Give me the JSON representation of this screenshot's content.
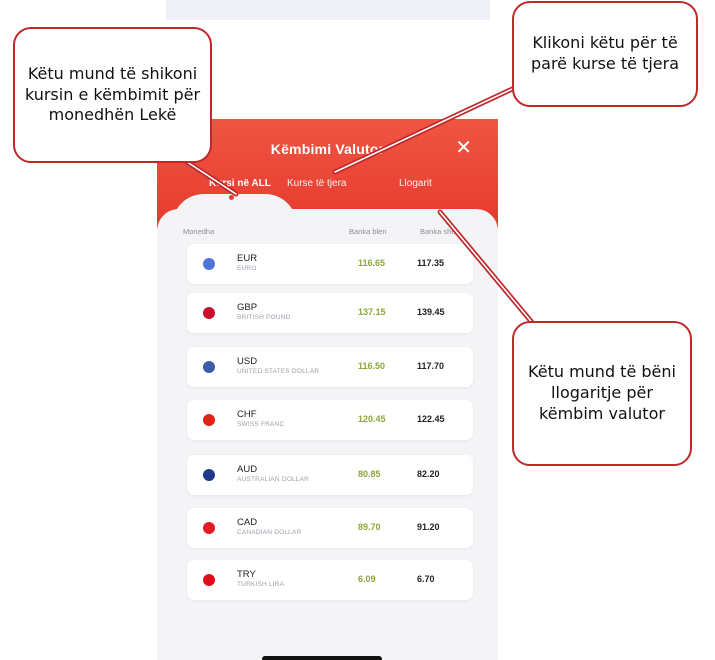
{
  "header": {
    "title": "Këmbimi Valutor",
    "close": "✕"
  },
  "tabs": [
    {
      "label": "Kursi në ALL"
    },
    {
      "label": "Kurse të tjera"
    },
    {
      "label": "Llogarit"
    }
  ],
  "columns": {
    "currency": "Monedha",
    "buy": "Banka blen",
    "sell": "Banka shet"
  },
  "rows": [
    {
      "code": "EUR",
      "name": "EURO",
      "buy": "116.65",
      "sell": "117.35",
      "flag": "#4f74d6"
    },
    {
      "code": "GBP",
      "name": "BRITISH POUND",
      "buy": "137.15",
      "sell": "139.45",
      "flag": "#c8102e"
    },
    {
      "code": "USD",
      "name": "UNITED STATES DOLLAR",
      "buy": "116.50",
      "sell": "117.70",
      "flag": "#3c5ba8"
    },
    {
      "code": "CHF",
      "name": "SWISS FRANC",
      "buy": "120.45",
      "sell": "122.45",
      "flag": "#e2231a"
    },
    {
      "code": "AUD",
      "name": "AUSTRALIAN DOLLAR",
      "buy": "80.85",
      "sell": "82.20",
      "flag": "#1f3a8a"
    },
    {
      "code": "CAD",
      "name": "CANADIAN DOLLAR",
      "buy": "89.70",
      "sell": "91.20",
      "flag": "#e31b23"
    },
    {
      "code": "TRY",
      "name": "TURKISH LIRA",
      "buy": "6.09",
      "sell": "6.70",
      "flag": "#e30a17"
    }
  ],
  "callouts": {
    "left": "Këtu mund të shikoni kursin e këmbimit për monedhën Lekë",
    "right": "Klikoni këtu për të parë kurse të tjera",
    "bottom": "Këtu mund të bëni llogaritje për këmbim valutor"
  },
  "colors": {
    "accent": "#e63a2e",
    "callout_border": "#c0292b",
    "buy_text": "#8aa63a"
  }
}
